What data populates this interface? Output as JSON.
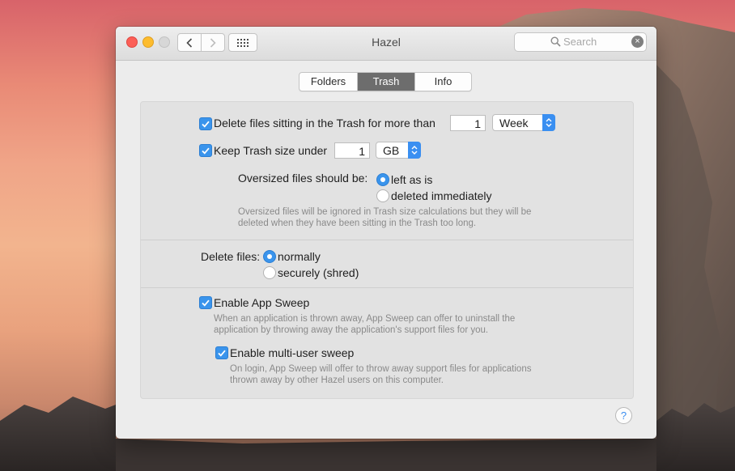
{
  "window": {
    "title": "Hazel"
  },
  "search": {
    "placeholder": "Search",
    "clear_glyph": "×"
  },
  "tabs": [
    {
      "label": "Folders",
      "active": false
    },
    {
      "label": "Trash",
      "active": true
    },
    {
      "label": "Info",
      "active": false
    }
  ],
  "trash": {
    "delete_older": {
      "label": "Delete files sitting in the Trash for more than",
      "checked": true,
      "amount": "1",
      "unit": "Week"
    },
    "keep_size": {
      "label": "Keep Trash size under",
      "checked": true,
      "amount": "1",
      "unit": "GB"
    },
    "oversized": {
      "label": "Oversized files should be:",
      "options": [
        {
          "label": "left as is",
          "selected": true
        },
        {
          "label": "deleted immediately",
          "selected": false
        }
      ],
      "note_line1": "Oversized files will be ignored in Trash size calculations but they will be",
      "note_line2": "deleted when they have been sitting in the Trash too long."
    }
  },
  "delete_files": {
    "label": "Delete files:",
    "options": [
      {
        "label": "normally",
        "selected": true
      },
      {
        "label": "securely (shred)",
        "selected": false
      }
    ]
  },
  "app_sweep": {
    "label": "Enable App Sweep",
    "checked": true,
    "note_line1": "When an application is thrown away, App Sweep can offer to uninstall the",
    "note_line2": "application by throwing away the application's support files for you.",
    "multi_user": {
      "label": "Enable multi-user sweep",
      "checked": true,
      "note_line1": "On login, App Sweep will offer to throw away support files for applications",
      "note_line2": "thrown away by other Hazel users on this computer."
    }
  },
  "help": {
    "glyph": "?"
  },
  "colors": {
    "accent": "#3a94ec",
    "tab_active": "#6d6d6d",
    "close": "#fc5f57",
    "minimize": "#fdbc2e"
  }
}
